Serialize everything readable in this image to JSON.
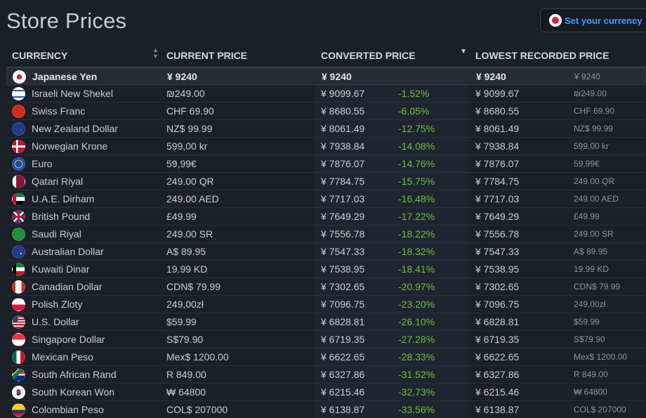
{
  "page": {
    "title": "Store Prices"
  },
  "currency_button": {
    "label": "Set your currency"
  },
  "table": {
    "headers": {
      "currency": "CURRENCY",
      "current_price": "CURRENT PRICE",
      "converted_price": "CONVERTED PRICE",
      "lowest_recorded_price": "LOWEST RECORDED PRICE"
    },
    "rows": [
      {
        "name": "Japanese Yen",
        "current": "¥ 9240",
        "converted": "¥ 9240",
        "pct": "",
        "lowest": "¥ 9240",
        "lowest_raw": "¥ 9240",
        "flag": "jp"
      },
      {
        "name": "Israeli New Shekel",
        "current": "₪249.00",
        "converted": "¥ 9099.67",
        "pct": "-1.52%",
        "lowest": "¥ 9099.67",
        "lowest_raw": "₪249.00",
        "flag": "il"
      },
      {
        "name": "Swiss Franc",
        "current": "CHF 69.90",
        "converted": "¥ 8680.55",
        "pct": "-6.05%",
        "lowest": "¥ 8680.55",
        "lowest_raw": "CHF 69.90",
        "flag": "ch"
      },
      {
        "name": "New Zealand Dollar",
        "current": "NZ$ 99.99",
        "converted": "¥ 8061.49",
        "pct": "-12.75%",
        "lowest": "¥ 8061.49",
        "lowest_raw": "NZ$ 99.99",
        "flag": "nz"
      },
      {
        "name": "Norwegian Krone",
        "current": "599,00 kr",
        "converted": "¥ 7938.84",
        "pct": "-14.08%",
        "lowest": "¥ 7938.84",
        "lowest_raw": "599,00 kr",
        "flag": "no"
      },
      {
        "name": "Euro",
        "current": "59,99€",
        "converted": "¥ 7876.07",
        "pct": "-14.76%",
        "lowest": "¥ 7876.07",
        "lowest_raw": "59,99€",
        "flag": "eu"
      },
      {
        "name": "Qatari Riyal",
        "current": "249.00 QR",
        "converted": "¥ 7784.75",
        "pct": "-15.75%",
        "lowest": "¥ 7784.75",
        "lowest_raw": "249.00 QR",
        "flag": "qa"
      },
      {
        "name": "U.A.E. Dirham",
        "current": "249.00 AED",
        "converted": "¥ 7717.03",
        "pct": "-16.48%",
        "lowest": "¥ 7717.03",
        "lowest_raw": "249.00 AED",
        "flag": "ae"
      },
      {
        "name": "British Pound",
        "current": "£49.99",
        "converted": "¥ 7649.29",
        "pct": "-17.22%",
        "lowest": "¥ 7649.29",
        "lowest_raw": "£49.99",
        "flag": "gb"
      },
      {
        "name": "Saudi Riyal",
        "current": "249.00 SR",
        "converted": "¥ 7556.78",
        "pct": "-18.22%",
        "lowest": "¥ 7556.78",
        "lowest_raw": "249.00 SR",
        "flag": "sa"
      },
      {
        "name": "Australian Dollar",
        "current": "A$ 89.95",
        "converted": "¥ 7547.33",
        "pct": "-18.32%",
        "lowest": "¥ 7547.33",
        "lowest_raw": "A$ 89.95",
        "flag": "au"
      },
      {
        "name": "Kuwaiti Dinar",
        "current": "19.99 KD",
        "converted": "¥ 7538.95",
        "pct": "-18.41%",
        "lowest": "¥ 7538.95",
        "lowest_raw": "19.99 KD",
        "flag": "kw"
      },
      {
        "name": "Canadian Dollar",
        "current": "CDN$ 79.99",
        "converted": "¥ 7302.65",
        "pct": "-20.97%",
        "lowest": "¥ 7302.65",
        "lowest_raw": "CDN$ 79.99",
        "flag": "ca"
      },
      {
        "name": "Polish Zloty",
        "current": "249,00zł",
        "converted": "¥ 7096.75",
        "pct": "-23.20%",
        "lowest": "¥ 7096.75",
        "lowest_raw": "249,00zł",
        "flag": "pl"
      },
      {
        "name": "U.S. Dollar",
        "current": "$59.99",
        "converted": "¥ 6828.81",
        "pct": "-26.10%",
        "lowest": "¥ 6828.81",
        "lowest_raw": "$59.99",
        "flag": "us"
      },
      {
        "name": "Singapore Dollar",
        "current": "S$79.90",
        "converted": "¥ 6719.35",
        "pct": "-27.28%",
        "lowest": "¥ 6719.35",
        "lowest_raw": "S$79.90",
        "flag": "sg"
      },
      {
        "name": "Mexican Peso",
        "current": "Mex$ 1200.00",
        "converted": "¥ 6622.65",
        "pct": "-28.33%",
        "lowest": "¥ 6622.65",
        "lowest_raw": "Mex$ 1200.00",
        "flag": "mx"
      },
      {
        "name": "South African Rand",
        "current": "R 849.00",
        "converted": "¥ 6327.86",
        "pct": "-31.52%",
        "lowest": "¥ 6327.86",
        "lowest_raw": "R 849.00",
        "flag": "za"
      },
      {
        "name": "South Korean Won",
        "current": "₩ 64800",
        "converted": "¥ 6215.46",
        "pct": "-32.73%",
        "lowest": "¥ 6215.46",
        "lowest_raw": "₩ 64800",
        "flag": "kr"
      },
      {
        "name": "Colombian Peso",
        "current": "COL$ 207000",
        "converted": "¥ 6138.87",
        "pct": "-33.56%",
        "lowest": "¥ 6138.87",
        "lowest_raw": "COL$ 207000",
        "flag": "co"
      }
    ]
  },
  "colors": {
    "accent": "#3aa0ff",
    "discount": "#67c23a",
    "background": "#1b1f27"
  }
}
